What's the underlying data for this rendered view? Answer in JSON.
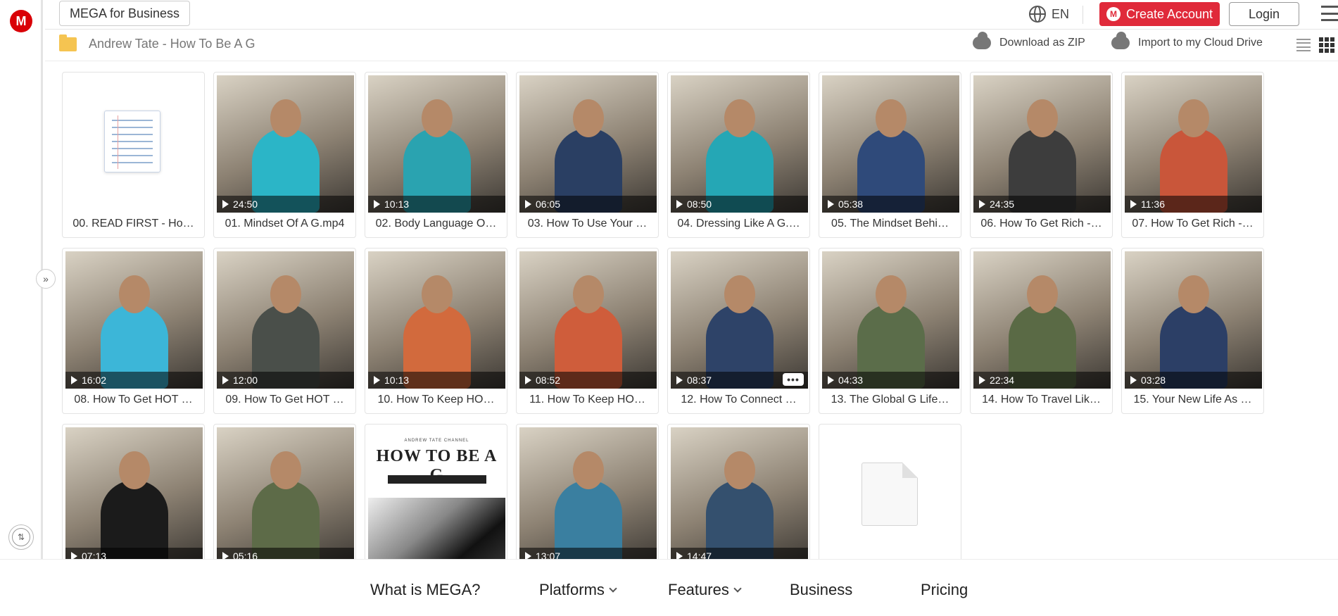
{
  "app": {
    "logo": "M"
  },
  "header": {
    "business_label": "MEGA for Business",
    "lang": "EN",
    "create_account": "Create Account",
    "login": "Login"
  },
  "pathbar": {
    "folder_name": "Andrew Tate - How To Be A G",
    "download_zip": "Download as ZIP",
    "import_label": "Import to my Cloud Drive"
  },
  "files": [
    {
      "name": "00. READ FIRST - Ho…",
      "kind": "doc"
    },
    {
      "name": "01. Mindset Of A G.mp4",
      "duration": "24:50",
      "kind": "video",
      "color": "#2bb5c7"
    },
    {
      "name": "02. Body Language O…",
      "duration": "10:13",
      "kind": "video",
      "color": "#2aa3b0"
    },
    {
      "name": "03. How To Use Your …",
      "duration": "06:05",
      "kind": "video",
      "color": "#2a3f63"
    },
    {
      "name": "04. Dressing Like A G.…",
      "duration": "08:50",
      "kind": "video",
      "color": "#25a7b5"
    },
    {
      "name": "05. The Mindset Behi…",
      "duration": "05:38",
      "kind": "video",
      "color": "#2f4a7a"
    },
    {
      "name": "06. How To Get Rich -…",
      "duration": "24:35",
      "kind": "video",
      "color": "#3d3d3d"
    },
    {
      "name": "07. How To Get Rich -…",
      "duration": "11:36",
      "kind": "video",
      "color": "#c9563a"
    },
    {
      "name": "08. How To Get HOT …",
      "duration": "16:02",
      "kind": "video",
      "color": "#3cb6d8"
    },
    {
      "name": "09. How To Get HOT …",
      "duration": "12:00",
      "kind": "video",
      "color": "#4a4f4a"
    },
    {
      "name": "10. How To Keep HO…",
      "duration": "10:13",
      "kind": "video",
      "color": "#d26a3d"
    },
    {
      "name": "11. How To Keep HO…",
      "duration": "08:52",
      "kind": "video",
      "color": "#cf5d3b"
    },
    {
      "name": "12. How To Connect …",
      "duration": "08:37",
      "kind": "video",
      "color": "#2e4368",
      "more": "•••"
    },
    {
      "name": "13. The Global G Life…",
      "duration": "04:33",
      "kind": "video",
      "color": "#5b6d4a"
    },
    {
      "name": "14. How To Travel Lik…",
      "duration": "22:34",
      "kind": "video",
      "color": "#5a6a45"
    },
    {
      "name": "15. Your New Life As …",
      "duration": "03:28",
      "kind": "video",
      "color": "#2c3f66"
    },
    {
      "name": "",
      "duration": "07:13",
      "kind": "video",
      "color": "#1b1b1b"
    },
    {
      "name": "",
      "duration": "05:16",
      "kind": "video",
      "color": "#5d6b48"
    },
    {
      "name": "",
      "kind": "pdf",
      "pdf_small": "ANDREW TATE CHANNEL",
      "pdf_title": "HOW TO BE A G"
    },
    {
      "name": "",
      "duration": "13:07",
      "kind": "video",
      "color": "#3a7fa0"
    },
    {
      "name": "",
      "duration": "14:47",
      "kind": "video",
      "color": "#34506e"
    },
    {
      "name": "",
      "kind": "blank"
    }
  ],
  "bottom_nav": {
    "what_is": "What is MEGA?",
    "platforms": "Platforms",
    "features": "Features",
    "business": "Business",
    "pricing": "Pricing"
  }
}
